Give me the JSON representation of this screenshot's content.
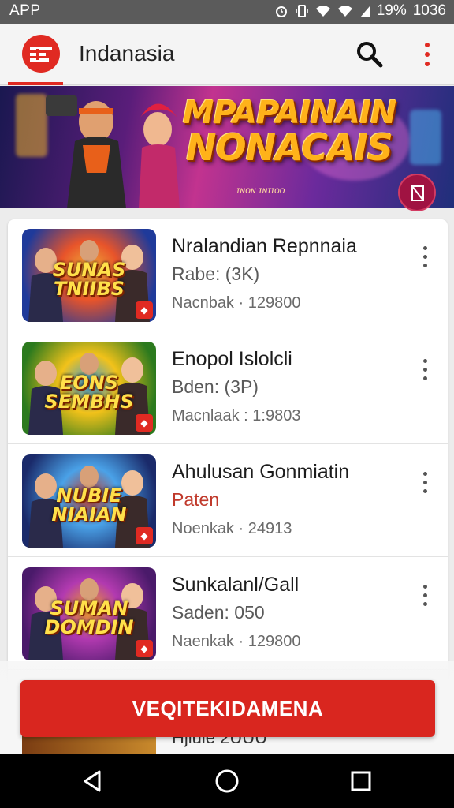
{
  "status_bar": {
    "left_label": "APP",
    "battery": "19%",
    "time": "1036",
    "icons": [
      "alarm-icon",
      "vibrate-icon",
      "wifi-icon",
      "signal-icon"
    ]
  },
  "app_bar": {
    "title": "Indanasia",
    "logo_icon": "ticket-icon",
    "search_icon": "search-icon",
    "menu_icon": "more-vert-icon"
  },
  "banner": {
    "title_line1": "MPAPAINAIN",
    "title_line2": "NONACAIS",
    "subtitle": "ɪɴᴏɴ ɪɴɪɪᴏᴏ",
    "badge_icon": "bookmark-icon"
  },
  "games": [
    {
      "title": "Nralandian Repnnaia",
      "subtitle": "Rabe: (3K)",
      "meta": "Nacnbak · 129800",
      "thumb_text": "SUNAS TNIIBS",
      "thumb_colors": [
        "#1f3a9a",
        "#e8542a",
        "#f0b23a"
      ]
    },
    {
      "title": "Enopol Islolcli",
      "subtitle": "Bden: (3P)",
      "meta": "Macnlaak : 1:9803",
      "thumb_text": "EONS SEMBHS",
      "thumb_colors": [
        "#2c7a1e",
        "#f2c21a",
        "#3a9ad8"
      ]
    },
    {
      "title": "Ahulusan Gonmiatin",
      "subtitle": "Paten",
      "meta": "Noenkak · 24913",
      "thumb_text": "NUBIE NIAIAN",
      "thumb_colors": [
        "#1a2a6a",
        "#4aa2e8",
        "#c23a2a"
      ]
    },
    {
      "title": "Sunkalanl/Gall",
      "subtitle": "Saden: 050",
      "meta": "Naenkak · 129800",
      "thumb_text": "SUMAN DOMDIN",
      "thumb_colors": [
        "#4a1a6a",
        "#b23ab0",
        "#f0a020"
      ]
    }
  ],
  "peek_text": "Hjlule 2UUU",
  "cta_label": "VEQITEKIDAMENA",
  "nav": {
    "back": "back-icon",
    "home": "home-icon",
    "recents": "recents-icon"
  }
}
